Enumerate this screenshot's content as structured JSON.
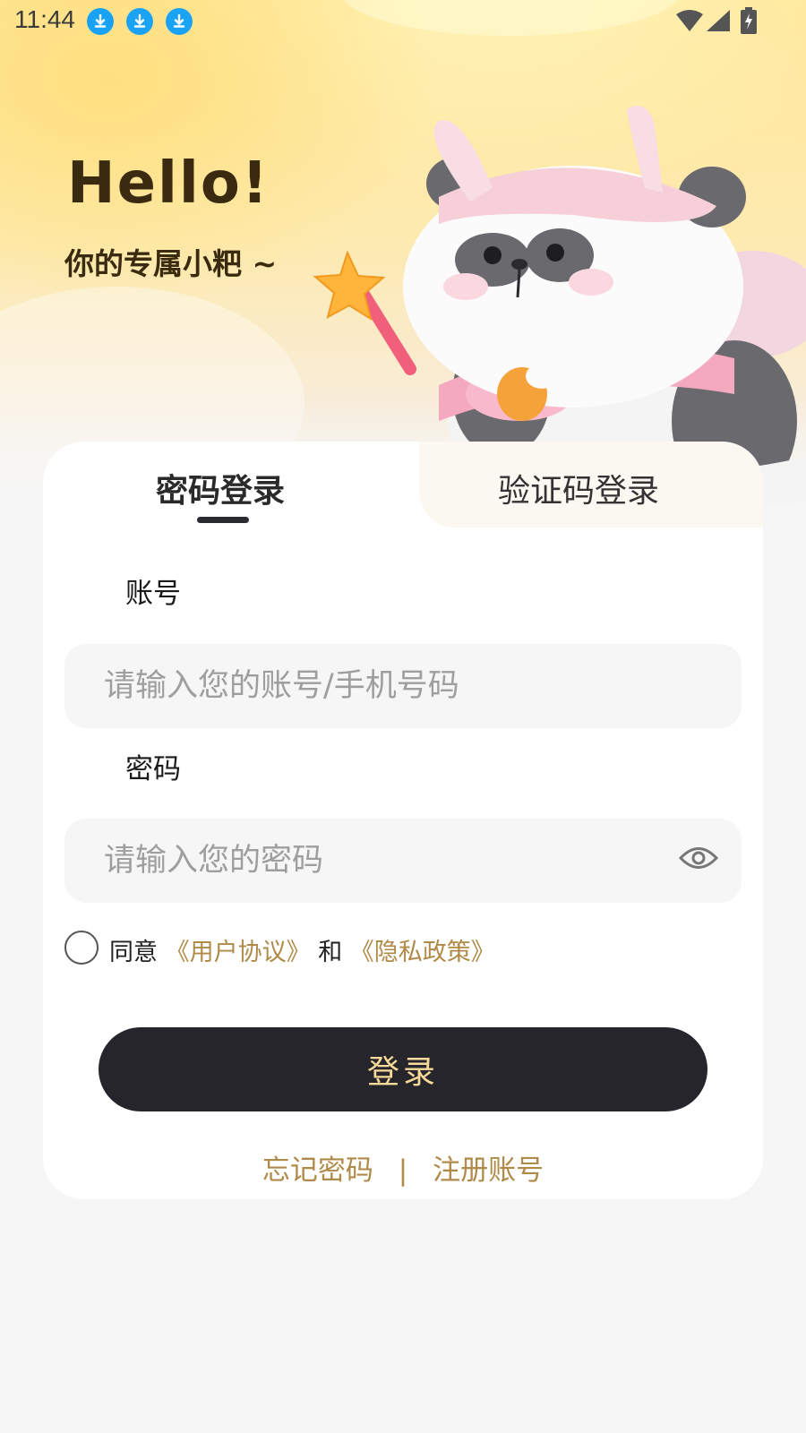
{
  "status_bar": {
    "time": "11:44",
    "icons": [
      "download-icon",
      "download-icon",
      "download-icon",
      "wifi-icon",
      "signal-icon",
      "battery-charging-icon"
    ]
  },
  "greeting": {
    "hello": "Hello!",
    "subtitle": "你的专属小粑 ~"
  },
  "tabs": [
    {
      "label": "密码登录",
      "active": true
    },
    {
      "label": "验证码登录",
      "active": false
    }
  ],
  "form": {
    "account_label": "账号",
    "account_placeholder": "请输入您的账号/手机号码",
    "password_label": "密码",
    "password_placeholder": "请输入您的密码"
  },
  "agreement": {
    "prefix": "同意",
    "user_agreement": "《用户协议》",
    "conjunction": "和",
    "privacy_policy": "《隐私政策》"
  },
  "login_button": "登录",
  "links": {
    "forgot_password": "忘记密码",
    "separator": "|",
    "register": "注册账号"
  },
  "colors": {
    "accent_gold": "#b08a48",
    "button_bg": "#26252b",
    "button_text": "#f7d99a",
    "header_yellow": "#ffe79a"
  }
}
